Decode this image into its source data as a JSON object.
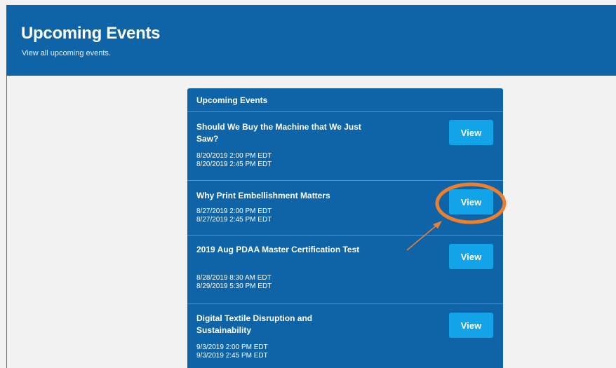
{
  "header": {
    "title": "Upcoming Events",
    "subtitle": "View all upcoming events."
  },
  "panel": {
    "heading": "Upcoming Events",
    "events": [
      {
        "title": "Should We Buy the Machine that We Just Saw?",
        "start": "8/20/2019 2:00 PM EDT",
        "end": "8/20/2019 2:45 PM EDT",
        "button_label": "View"
      },
      {
        "title": "Why Print Embellishment Matters",
        "start": "8/27/2019 2:00 PM EDT",
        "end": "8/27/2019 2:45 PM EDT",
        "button_label": "View"
      },
      {
        "title": "2019 Aug PDAA Master Certification Test",
        "start": "8/28/2019 8:30 AM EDT",
        "end": "8/29/2019 5:30 PM EDT",
        "button_label": "View"
      },
      {
        "title": "Digital Textile Disruption and Sustainability",
        "start": "9/3/2019 2:00 PM EDT",
        "end": "9/3/2019 2:45 PM EDT",
        "button_label": "View"
      }
    ]
  },
  "colors": {
    "header_bg": "#0f64a8",
    "panel_bg": "#0f64a8",
    "button_bg": "#12a3e8",
    "page_bg": "#f2f2f2",
    "annotation": "#ee7f2d"
  }
}
